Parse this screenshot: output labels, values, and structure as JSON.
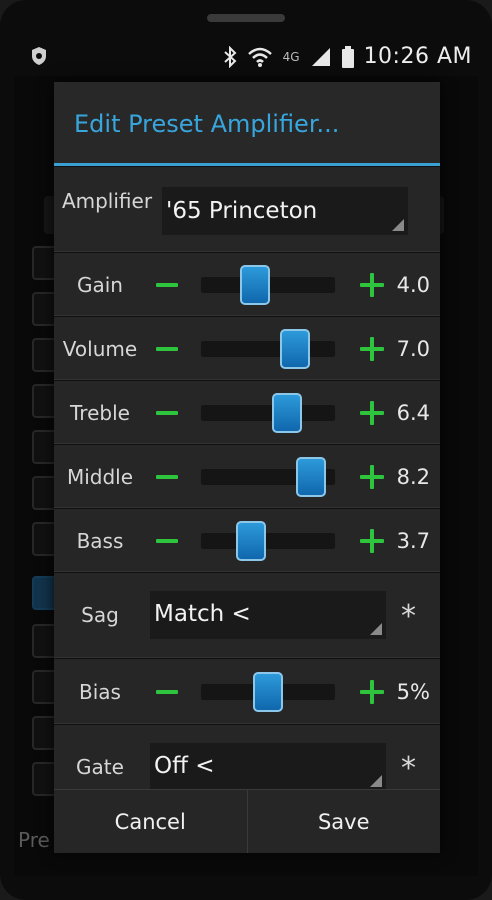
{
  "status_bar": {
    "time": "10:26 AM",
    "network_label": "4G",
    "icons": [
      "shield-icon",
      "bluetooth-icon",
      "wifi-icon",
      "signal-icon",
      "battery-icon"
    ]
  },
  "background": {
    "partial_text": "Pre"
  },
  "dialog": {
    "title": "Edit Preset Amplifier...",
    "amplifier": {
      "label": "Amplifier",
      "value": "'65 Princeton"
    },
    "sliders": [
      {
        "label": "Gain",
        "value": "4.0",
        "level": 0.4
      },
      {
        "label": "Volume",
        "value": "7.0",
        "level": 0.7
      },
      {
        "label": "Treble",
        "value": "6.4",
        "level": 0.64
      },
      {
        "label": "Middle",
        "value": "8.2",
        "level": 0.82
      },
      {
        "label": "Bass",
        "value": "3.7",
        "level": 0.37
      }
    ],
    "sag": {
      "label": "Sag",
      "value": "Match <",
      "star": "*"
    },
    "bias": {
      "label": "Bias",
      "value": "5%",
      "level": 0.5
    },
    "gate": {
      "label": "Gate",
      "value": "Off <",
      "star": "*"
    },
    "cancel_label": "Cancel",
    "save_label": "Save"
  },
  "colors": {
    "accent": "#38a6dc",
    "plus_minus": "#2ec43d",
    "knob": "#1f82c8"
  }
}
